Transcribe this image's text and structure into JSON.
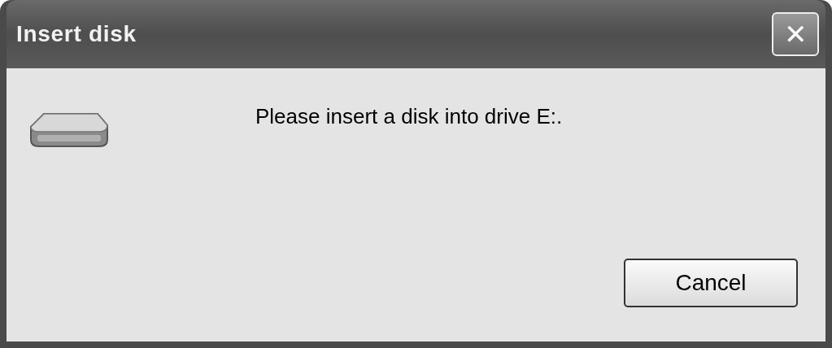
{
  "window": {
    "title": "Insert disk",
    "close": "✕"
  },
  "message": "Please insert a disk into drive E:.",
  "buttons": [
    {
      "label": "Cancel"
    }
  ]
}
